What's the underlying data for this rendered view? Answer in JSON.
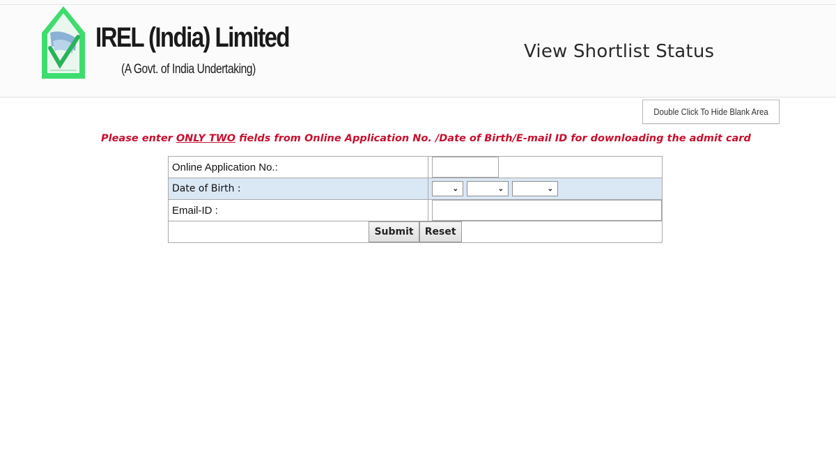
{
  "header": {
    "org_name": "IREL (India) Limited",
    "org_subtitle": "(A Govt. of India Undertaking)",
    "page_title": "View Shortlist Status",
    "logo_color": "#3ddc6e"
  },
  "toolbar": {
    "hide_blank_label": "Double Click To Hide Blank Area"
  },
  "instruction": {
    "prefix": "Please enter ",
    "emphasis": "ONLY TWO",
    "suffix": " fields from Online Application No. /Date of Birth/E-mail ID for downloading the admit card",
    "color": "#c8102e"
  },
  "form": {
    "application_label": "Online Application No.:",
    "application_value": "",
    "dob_label": "Date of Birth :",
    "dob_day": "",
    "dob_month": "",
    "dob_year": "",
    "email_label": "Email-ID :",
    "email_value": "",
    "submit_label": "Submit",
    "reset_label": "Reset",
    "alt_row_color": "#dae7f5"
  }
}
